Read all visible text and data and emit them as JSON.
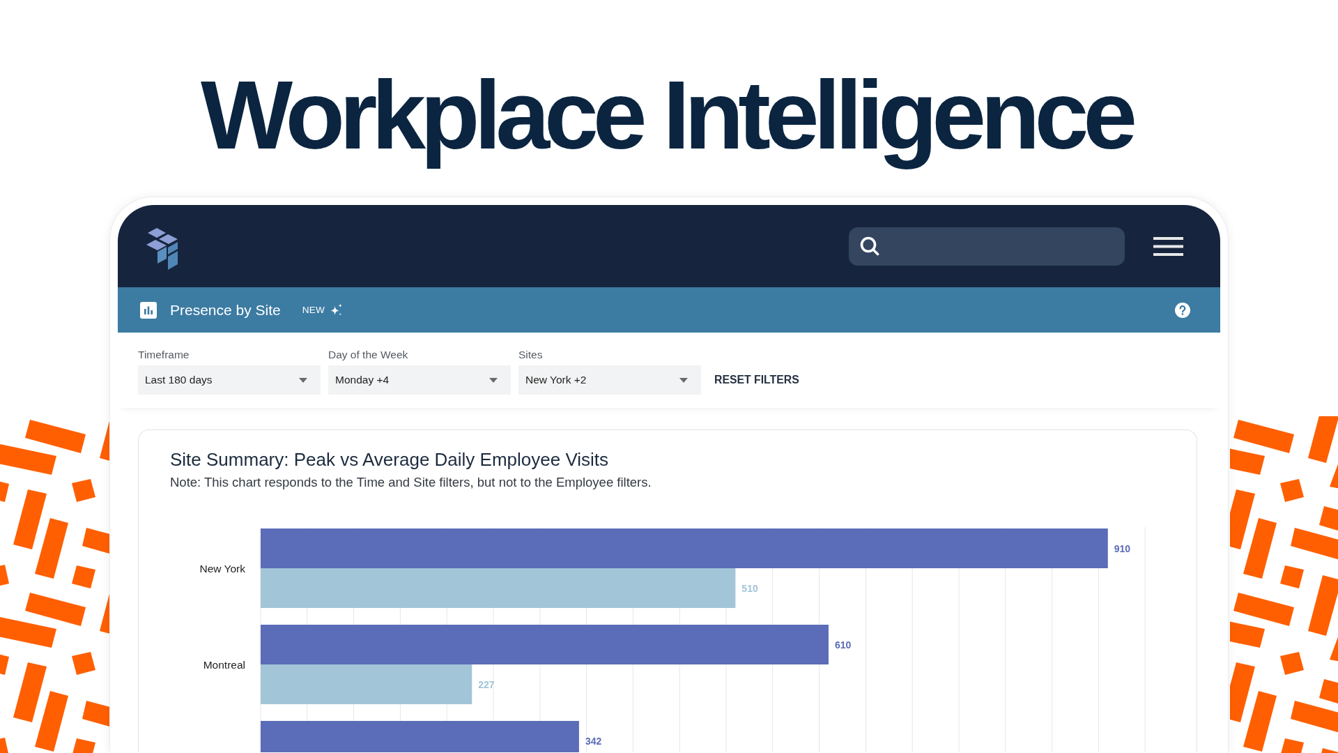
{
  "headline": "Workplace Intelligence",
  "page_bar": {
    "title": "Presence by Site",
    "badge": "NEW"
  },
  "filters": [
    {
      "label": "Timeframe",
      "value": "Last 180 days"
    },
    {
      "label": "Day of the Week",
      "value": "Monday +4"
    },
    {
      "label": "Sites",
      "value": "New York +2"
    }
  ],
  "reset_button": "RESET FILTERS",
  "chart_card": {
    "note": "Note: This chart responds to the Time and Site filters, but not to the Employee filters.",
    "chart_data": {
      "type": "bar",
      "orientation": "horizontal",
      "title": "Site Summary: Peak vs Average Daily Employee Visits",
      "categories": [
        "New York",
        "Montreal",
        null
      ],
      "series": [
        {
          "color": "#5b6cb8",
          "values": [
            910,
            610,
            342
          ]
        },
        {
          "color": "#a2c5d8",
          "values": [
            510,
            227,
            null
          ]
        }
      ],
      "data_labels": true
    }
  }
}
